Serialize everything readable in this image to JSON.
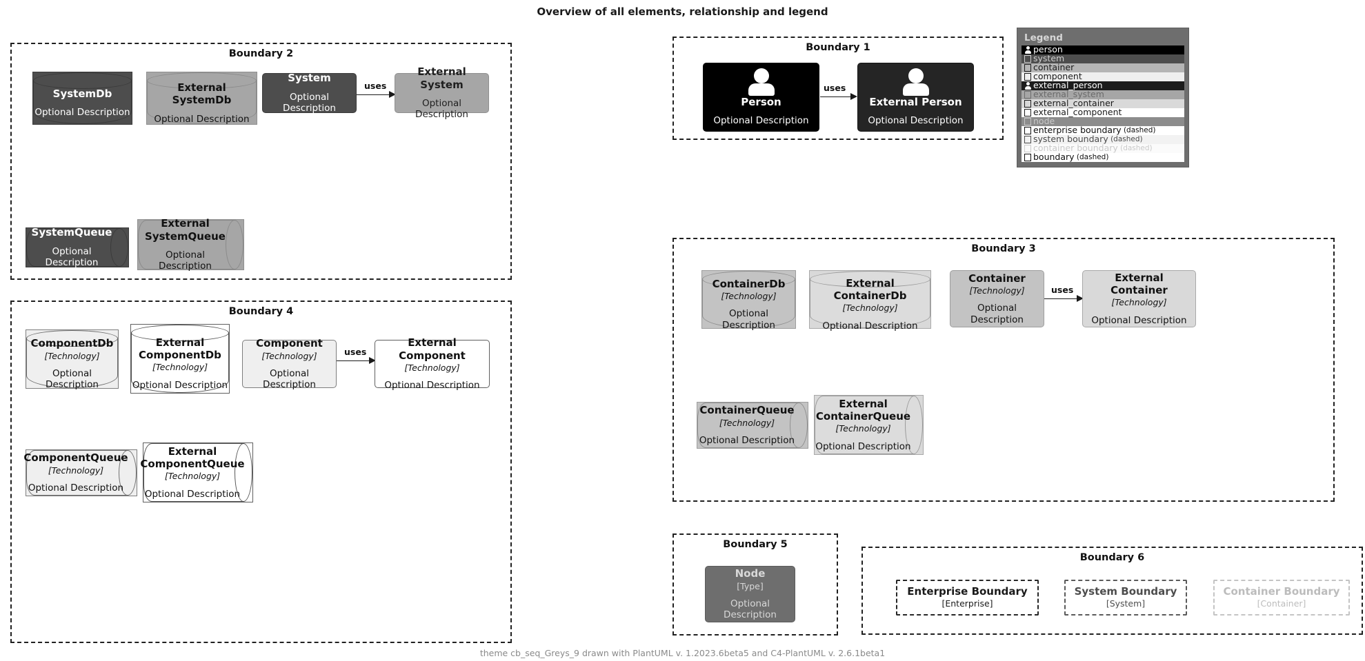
{
  "title": "Overview of all elements, relationship and legend",
  "footer": "theme cb_seq_Greys_9 drawn with PlantUML v. 1.2023.6beta5 and C4-PlantUML v. 2.6.1beta1",
  "labels": {
    "optional_description": "Optional Description",
    "technology": "[Technology]",
    "type": "[Type]",
    "uses": "uses"
  },
  "boundaries": {
    "b1": {
      "label": "Boundary 1"
    },
    "b2": {
      "label": "Boundary 2"
    },
    "b3": {
      "label": "Boundary 3"
    },
    "b4": {
      "label": "Boundary 4"
    },
    "b5": {
      "label": "Boundary 5"
    },
    "b6": {
      "label": "Boundary 6"
    }
  },
  "elements": {
    "person": {
      "name": "Person",
      "description": "Optional Description"
    },
    "external_person": {
      "name": "External Person",
      "description": "Optional Description"
    },
    "system_db": {
      "name": "SystemDb",
      "description": "Optional Description"
    },
    "external_system_db": {
      "name": "External SystemDb",
      "description": "Optional Description"
    },
    "system": {
      "name": "System",
      "description": "Optional Description"
    },
    "external_system": {
      "name": "External System",
      "description": "Optional Description"
    },
    "system_queue": {
      "name": "SystemQueue",
      "description": "Optional Description"
    },
    "external_system_queue": {
      "name": "External\nSystemQueue",
      "description": "Optional Description"
    },
    "container_db": {
      "name": "ContainerDb",
      "technology": "[Technology]",
      "description": "Optional Description"
    },
    "external_container_db": {
      "name": "External ContainerDb",
      "technology": "[Technology]",
      "description": "Optional Description"
    },
    "container": {
      "name": "Container",
      "technology": "[Technology]",
      "description": "Optional Description"
    },
    "external_container": {
      "name": "External Container",
      "technology": "[Technology]",
      "description": "Optional Description"
    },
    "container_queue": {
      "name": "ContainerQueue",
      "technology": "[Technology]",
      "description": "Optional Description"
    },
    "external_container_queue": {
      "name": "External\nContainerQueue",
      "technology": "[Technology]",
      "description": "Optional Description"
    },
    "component_db": {
      "name": "ComponentDb",
      "technology": "[Technology]",
      "description": "Optional Description"
    },
    "external_component_db": {
      "name": "External\nComponentDb",
      "technology": "[Technology]",
      "description": "Optional Description"
    },
    "component": {
      "name": "Component",
      "technology": "[Technology]",
      "description": "Optional Description"
    },
    "external_component": {
      "name": "External Component",
      "technology": "[Technology]",
      "description": "Optional Description"
    },
    "component_queue": {
      "name": "ComponentQueue",
      "technology": "[Technology]",
      "description": "Optional Description"
    },
    "external_component_queue": {
      "name": "External\nComponentQueue",
      "technology": "[Technology]",
      "description": "Optional Description"
    },
    "node": {
      "name": "Node",
      "technology": "[Type]",
      "description": "Optional Description"
    },
    "enterprise_boundary": {
      "name": "Enterprise Boundary",
      "technology": "[Enterprise]"
    },
    "system_boundary": {
      "name": "System Boundary",
      "technology": "[System]"
    },
    "container_boundary": {
      "name": "Container Boundary",
      "technology": "[Container]"
    }
  },
  "relationships": [
    {
      "id": "rel_person",
      "label": "uses"
    },
    {
      "id": "rel_system",
      "label": "uses"
    },
    {
      "id": "rel_container",
      "label": "uses"
    },
    {
      "id": "rel_component",
      "label": "uses"
    }
  ],
  "legend": {
    "title": "Legend",
    "rows": [
      {
        "key": "person",
        "icon": "person-icon",
        "label": "person",
        "suffix": ""
      },
      {
        "key": "system",
        "icon": "box-icon",
        "label": "system",
        "suffix": ""
      },
      {
        "key": "container",
        "icon": "box-icon",
        "label": "container",
        "suffix": ""
      },
      {
        "key": "component",
        "icon": "box-icon",
        "label": "component",
        "suffix": ""
      },
      {
        "key": "external_person",
        "icon": "person-icon",
        "label": "external_person",
        "suffix": ""
      },
      {
        "key": "external_system",
        "icon": "box-icon",
        "label": "external_system",
        "suffix": ""
      },
      {
        "key": "external_container",
        "icon": "box-icon",
        "label": "external_container",
        "suffix": ""
      },
      {
        "key": "external_component",
        "icon": "box-icon",
        "label": "external_component",
        "suffix": ""
      },
      {
        "key": "node",
        "icon": "box-icon",
        "label": "node",
        "suffix": ""
      },
      {
        "key": "enterprise_boundary",
        "icon": "box-icon",
        "label": "enterprise boundary",
        "suffix": "(dashed)"
      },
      {
        "key": "system_boundary",
        "icon": "box-icon",
        "label": "system boundary",
        "suffix": "(dashed)"
      },
      {
        "key": "container_boundary",
        "icon": "box-icon",
        "label": "container boundary",
        "suffix": "(dashed)"
      },
      {
        "key": "boundary",
        "icon": "box-icon",
        "label": "boundary",
        "suffix": "(dashed)"
      }
    ]
  },
  "colors": {
    "person": "#000000",
    "external_person": "#252525",
    "system": "#4d4d4d",
    "external_system": "#a6a6a6",
    "container": "#c3c3c3",
    "external_container": "#d9d9d9",
    "component": "#efefef",
    "external_component": "#ffffff",
    "node": "#6e6e6e",
    "legend_background": "#6e6e6e",
    "boundary_line": "#1f1f1f"
  }
}
